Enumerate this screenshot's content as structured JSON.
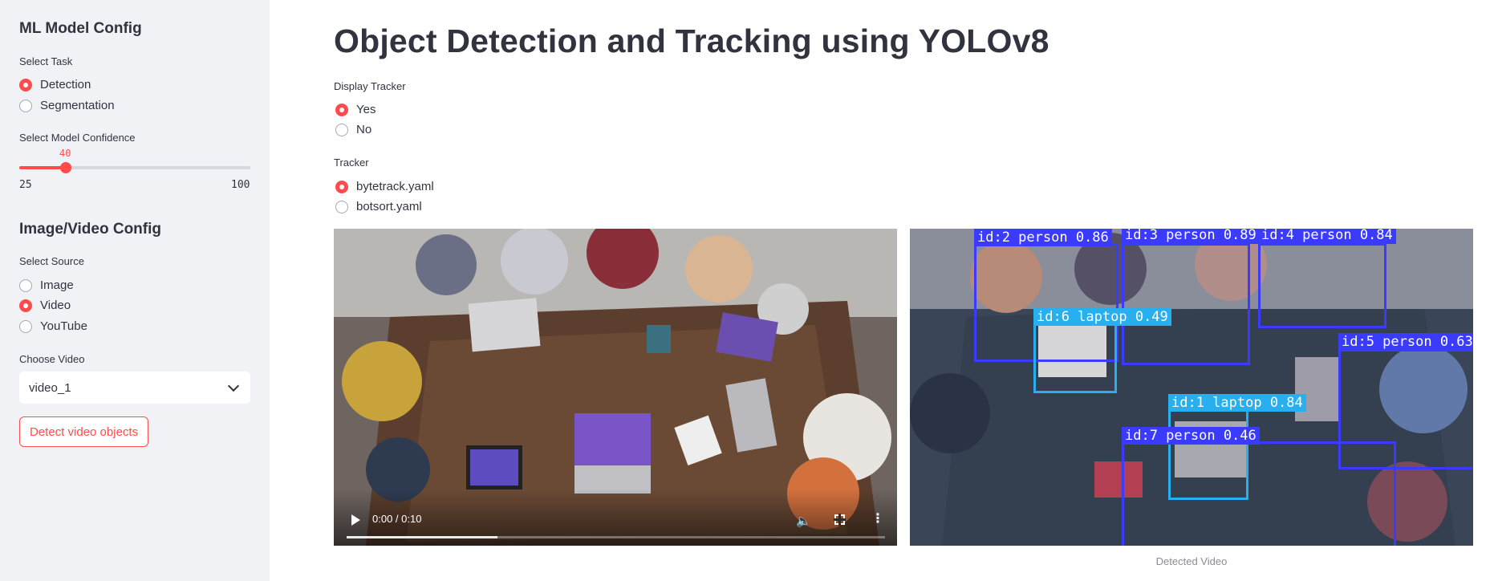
{
  "sidebar": {
    "ml_heading": "ML Model Config",
    "task_label": "Select Task",
    "task_options": [
      {
        "label": "Detection",
        "selected": true
      },
      {
        "label": "Segmentation",
        "selected": false
      }
    ],
    "confidence_label": "Select Model Confidence",
    "confidence": {
      "value": "40",
      "min": "25",
      "max": "100",
      "value_fraction": 0.2
    },
    "media_heading": "Image/Video Config",
    "source_label": "Select Source",
    "source_options": [
      {
        "label": "Image",
        "selected": false
      },
      {
        "label": "Video",
        "selected": true
      },
      {
        "label": "YouTube",
        "selected": false
      }
    ],
    "video_label": "Choose Video",
    "video_selected": "video_1",
    "detect_button": "Detect video objects"
  },
  "main": {
    "title": "Object Detection and Tracking using YOLOv8",
    "tracker_display_label": "Display Tracker",
    "tracker_display_options": [
      {
        "label": "Yes",
        "selected": true
      },
      {
        "label": "No",
        "selected": false
      }
    ],
    "tracker_label": "Tracker",
    "tracker_options": [
      {
        "label": "bytetrack.yaml",
        "selected": true
      },
      {
        "label": "botsort.yaml",
        "selected": false
      }
    ],
    "video_time": "0:00 / 0:10",
    "video_progress_fraction": 0.28,
    "detected_caption": "Detected Video",
    "detections": [
      {
        "label": "id:2 person 0.86",
        "color": "#3b3bff"
      },
      {
        "label": "id:3 person 0.89",
        "color": "#3b3bff"
      },
      {
        "label": "id:4 person 0.84",
        "color": "#3b3bff"
      },
      {
        "label": "id:6 laptop 0.49",
        "color": "#28aff0"
      },
      {
        "label": "id:5 person 0.63",
        "color": "#3b3bff"
      },
      {
        "label": "id:1 laptop 0.84",
        "color": "#28aff0"
      },
      {
        "label": "id:7 person 0.46",
        "color": "#3b3bff"
      }
    ]
  },
  "colors": {
    "accent": "#ff4b4b",
    "sidebar_bg": "#f0f2f6",
    "text": "#31333f"
  }
}
